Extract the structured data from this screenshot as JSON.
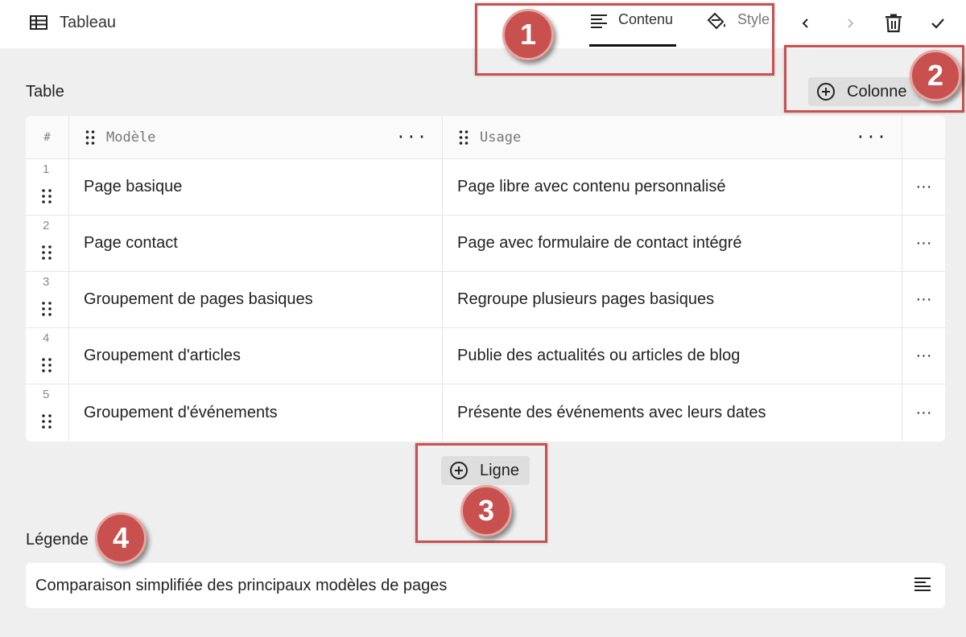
{
  "toolbar": {
    "title": "Tableau",
    "tabs": [
      {
        "label": "Contenu",
        "active": true
      },
      {
        "label": "Style",
        "active": false
      }
    ],
    "actions": [
      "chevron-left-icon",
      "chevron-right-icon",
      "trash-icon",
      "check-icon"
    ]
  },
  "table_section": {
    "label": "Table",
    "add_column_label": "Colonne",
    "header": {
      "index_symbol": "#",
      "columns": [
        "Modèle",
        "Usage"
      ],
      "more": "···"
    },
    "rows": [
      {
        "num": "1",
        "model": "Page basique",
        "usage": "Page libre avec contenu personnalisé"
      },
      {
        "num": "2",
        "model": "Page contact",
        "usage": "Page avec formulaire de contact intégré"
      },
      {
        "num": "3",
        "model": "Groupement de pages basiques",
        "usage": "Regroupe plusieurs pages basiques"
      },
      {
        "num": "4",
        "model": "Groupement d'articles",
        "usage": "Publie des actualités ou articles de blog"
      },
      {
        "num": "5",
        "model": "Groupement d'événements",
        "usage": "Présente des événements avec leurs dates"
      }
    ],
    "row_more": "···",
    "add_row_label": "Ligne"
  },
  "caption_section": {
    "label": "Légende",
    "value": "Comparaison simplifiée des principaux modèles de pages"
  },
  "annotations": [
    "1",
    "2",
    "3",
    "4"
  ],
  "colors": {
    "annotation": "#c8514f",
    "background": "#efefef",
    "surface": "#ffffff",
    "button": "#dedede"
  }
}
